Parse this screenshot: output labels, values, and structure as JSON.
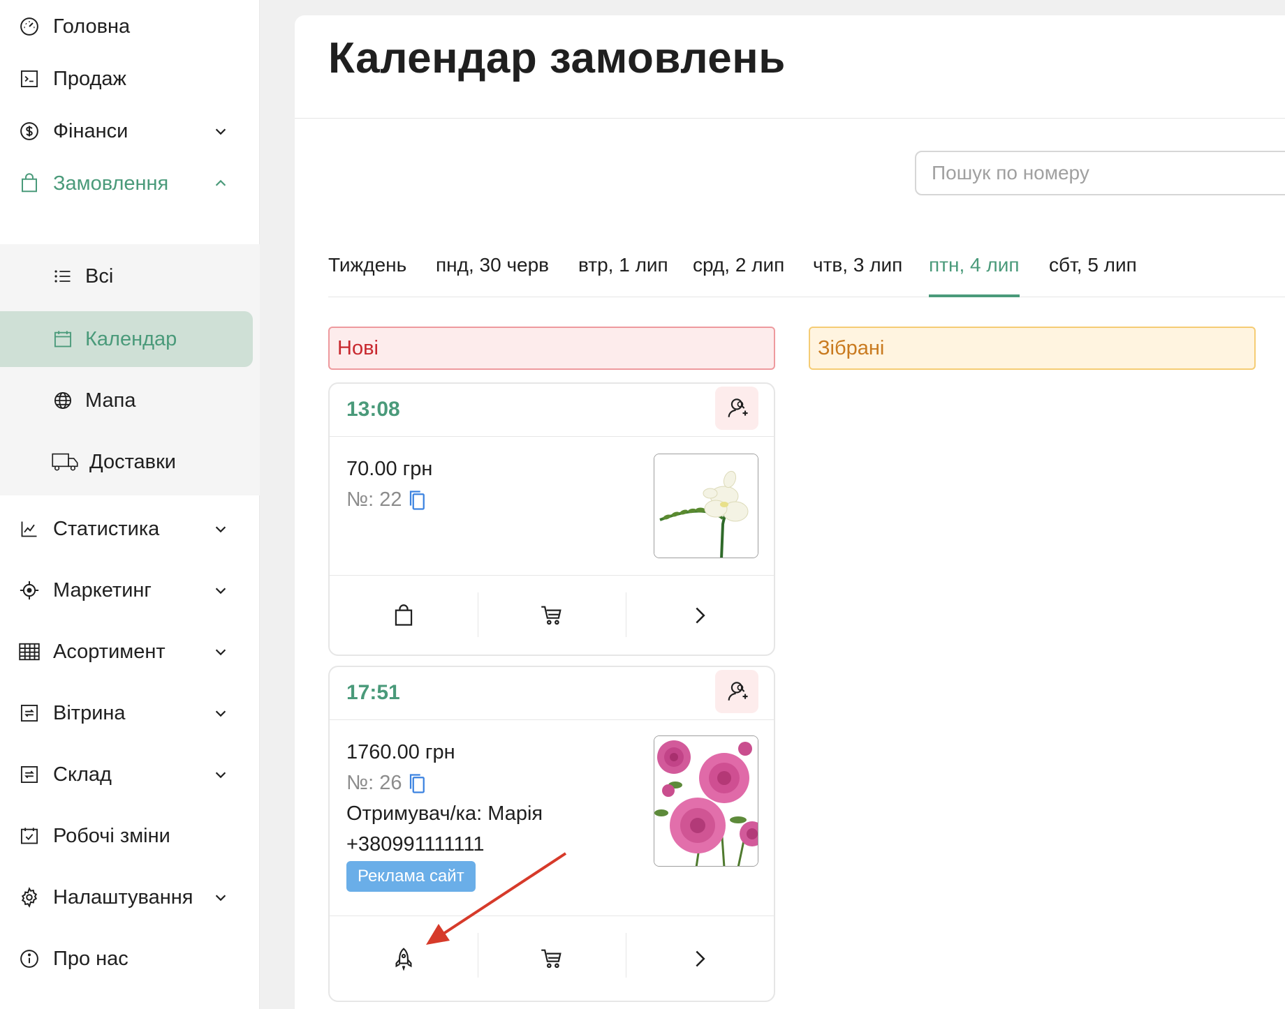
{
  "sidebar": {
    "items": [
      {
        "label": "Головна",
        "icon": "dashboard-icon",
        "has_chevron": false
      },
      {
        "label": "Продаж",
        "icon": "terminal-icon",
        "has_chevron": false
      },
      {
        "label": "Фінанси",
        "icon": "dollar-icon",
        "has_chevron": true
      },
      {
        "label": "Замовлення",
        "icon": "shopping-bag-icon",
        "has_chevron": true,
        "expanded": true
      },
      {
        "label": "Статистика",
        "icon": "chart-line-icon",
        "has_chevron": true
      },
      {
        "label": "Маркетинг",
        "icon": "target-icon",
        "has_chevron": true
      },
      {
        "label": "Асортимент",
        "icon": "grid-icon",
        "has_chevron": true
      },
      {
        "label": "Вітрина",
        "icon": "refresh-box-icon",
        "has_chevron": true
      },
      {
        "label": "Склад",
        "icon": "refresh-box-icon",
        "has_chevron": true
      },
      {
        "label": "Робочі зміни",
        "icon": "calendar-check-icon",
        "has_chevron": false
      },
      {
        "label": "Налаштування",
        "icon": "gear-icon",
        "has_chevron": true
      },
      {
        "label": "Про нас",
        "icon": "info-icon",
        "has_chevron": false
      }
    ],
    "orders_submenu": [
      {
        "label": "Всі",
        "icon": "list-icon"
      },
      {
        "label": "Календар",
        "icon": "calendar-icon",
        "active": true
      },
      {
        "label": "Мапа",
        "icon": "globe-icon"
      },
      {
        "label": "Доставки",
        "icon": "truck-icon"
      }
    ]
  },
  "page": {
    "title": "Календар замовлень",
    "search_placeholder": "Пошук по номеру"
  },
  "tabs": [
    {
      "label": "Тиждень"
    },
    {
      "label": "пнд, 30 черв"
    },
    {
      "label": "втр, 1 лип"
    },
    {
      "label": "срд, 2 лип"
    },
    {
      "label": "чтв, 3 лип"
    },
    {
      "label": "птн, 4 лип",
      "active": true
    },
    {
      "label": "сбт, 5 лип"
    }
  ],
  "columns": {
    "new": {
      "label": "Нові",
      "color": "#c8282e"
    },
    "collected": {
      "label": "Зібрані",
      "color": "#c97a1f"
    }
  },
  "orders": [
    {
      "time": "13:08",
      "price": "70.00 грн",
      "number": "№: 22",
      "image": "white-freesia-photo",
      "actions": [
        "shopping-bag-icon",
        "cart-icon",
        "chevron-right-icon"
      ]
    },
    {
      "time": "17:51",
      "price": "1760.00 грн",
      "number": "№: 26",
      "recipient": "Отримувач/ка: Марія",
      "phone": "+380991111111",
      "tag": "Реклама сайт",
      "image": "pink-roses-photo",
      "actions": [
        "rocket-icon",
        "cart-icon",
        "chevron-right-icon"
      ]
    }
  ],
  "colors": {
    "accent": "#4a9a7a",
    "active_bg": "#cfe0d6",
    "new_bg": "#fdecec",
    "collected_bg": "#fff4e0",
    "tag_bg": "#6aaee8",
    "annotation_arrow": "#d63a2a"
  }
}
